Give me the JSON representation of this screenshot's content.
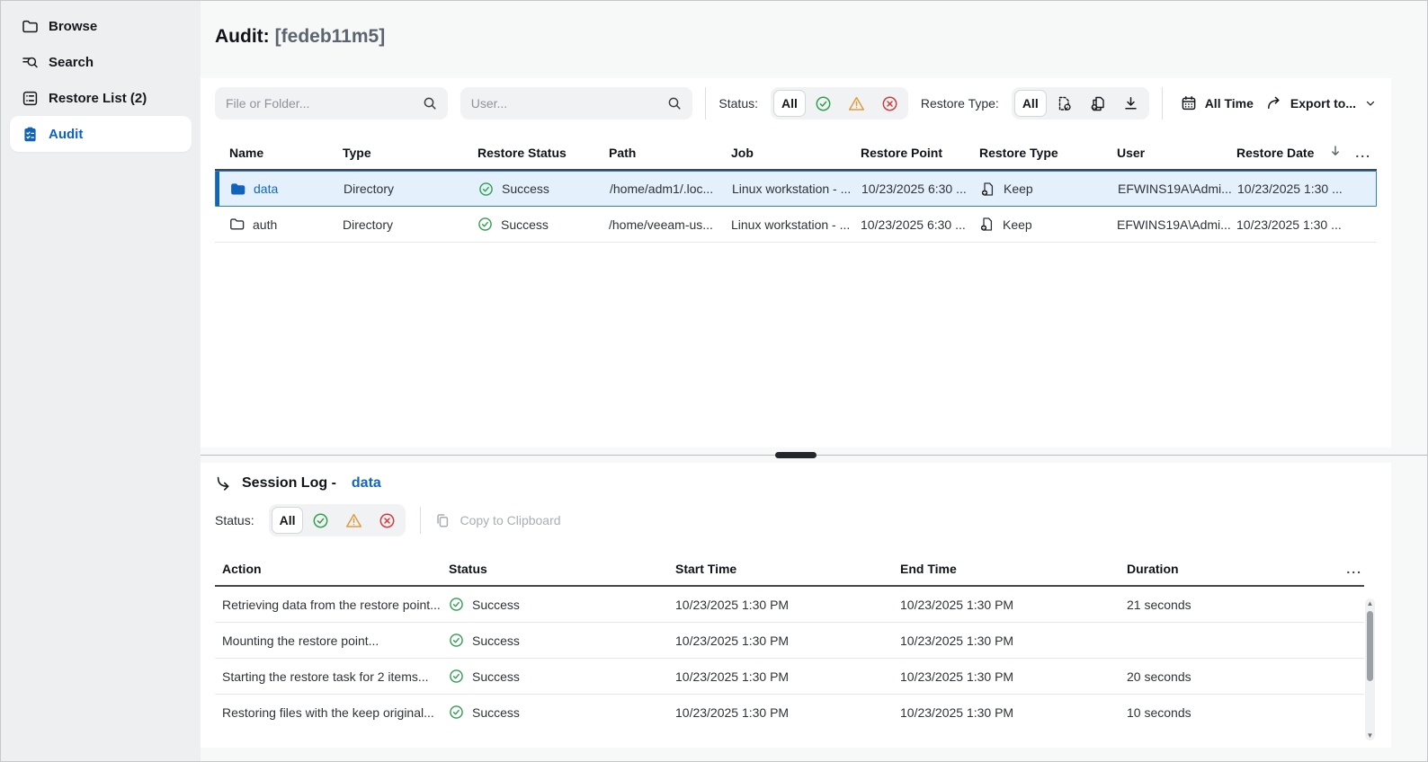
{
  "header": {
    "title_prefix": "Audit:",
    "title_machine": "[fedeb11m5]"
  },
  "sidebar": {
    "items": [
      {
        "label": "Browse",
        "icon": "folder-icon"
      },
      {
        "label": "Search",
        "icon": "search-lines-icon"
      },
      {
        "label": "Restore List (2)",
        "icon": "restore-list-icon"
      },
      {
        "label": "Audit",
        "icon": "audit-clipboard-icon",
        "active": true
      }
    ]
  },
  "filters": {
    "file_placeholder": "File or Folder...",
    "user_placeholder": "User...",
    "status_label": "Status:",
    "status_all": "All",
    "restore_type_label": "Restore Type:",
    "restore_type_all": "All",
    "time_range": "All Time",
    "export_label": "Export to..."
  },
  "table": {
    "columns": [
      "Name",
      "Type",
      "Restore Status",
      "Path",
      "Job",
      "Restore Point",
      "Restore Type",
      "User",
      "Restore Date"
    ],
    "more_label": "...",
    "sort_column": "Restore Date",
    "sort_direction": "descending",
    "rows": [
      {
        "name": "data",
        "type": "Directory",
        "status": "Success",
        "path": "/home/adm1/.loc...",
        "job": "Linux workstation - ...",
        "restore_point": "10/23/2025 6:30 ...",
        "restore_type": "Keep",
        "user": "EFWINS19A\\Admi...",
        "restore_date": "10/23/2025 1:30 ...",
        "selected": true
      },
      {
        "name": "auth",
        "type": "Directory",
        "status": "Success",
        "path": "/home/veeam-us...",
        "job": "Linux workstation - ...",
        "restore_point": "10/23/2025 6:30 ...",
        "restore_type": "Keep",
        "user": "EFWINS19A\\Admi...",
        "restore_date": "10/23/2025 1:30 ...",
        "selected": false
      }
    ]
  },
  "session_log": {
    "title_prefix": "Session Log -",
    "title_item": "data",
    "status_label": "Status:",
    "status_all": "All",
    "copy_label": "Copy to Clipboard",
    "columns": [
      "Action",
      "Status",
      "Start Time",
      "End Time",
      "Duration"
    ],
    "more_label": "...",
    "rows": [
      {
        "action": "Retrieving data from the restore point...",
        "status": "Success",
        "start": "10/23/2025 1:30 PM",
        "end": "10/23/2025 1:30 PM",
        "duration": "21 seconds"
      },
      {
        "action": "Mounting the restore point...",
        "status": "Success",
        "start": "10/23/2025 1:30 PM",
        "end": "10/23/2025 1:30 PM",
        "duration": ""
      },
      {
        "action": "Starting the restore task for 2 items...",
        "status": "Success",
        "start": "10/23/2025 1:30 PM",
        "end": "10/23/2025 1:30 PM",
        "duration": "20 seconds"
      },
      {
        "action": "Restoring files with the keep original...",
        "status": "Success",
        "start": "10/23/2025 1:30 PM",
        "end": "10/23/2025 1:30 PM",
        "duration": "10 seconds"
      }
    ]
  },
  "icons": {
    "status_success": "circle-check",
    "status_warning": "triangle-exclamation",
    "status_error": "circle-x",
    "restore_type_restore": "document-dashed-badge",
    "restore_type_keep": "document-copy-badge",
    "restore_type_download": "download-arrow",
    "time_filter": "calendar",
    "export": "curved-arrow-right",
    "session_log": "branch-arrow",
    "copy": "copy-pages",
    "more_menu": "ellipsis"
  },
  "colors": {
    "accent_blue": "#0f63b8",
    "link_blue": "#1167c0",
    "selected_row_bg": "#e4f0fb",
    "selected_row_border": "#2e7dc7",
    "success_green": "#2f9e4f",
    "warning_orange": "#df9c3c",
    "error_red": "#d23b3b",
    "sidebar_bg": "#edeff1",
    "app_bg": "#f7f8f8"
  }
}
